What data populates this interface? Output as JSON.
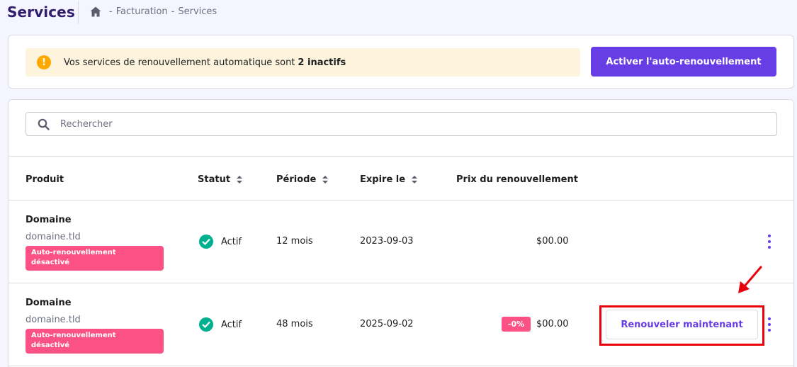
{
  "header": {
    "title": "Services",
    "breadcrumb": {
      "sep1": "-",
      "item1": "Facturation",
      "sep2": "-",
      "item2": "Services"
    }
  },
  "notice": {
    "text": "Vos services de renouvellement automatique sont",
    "highlight": "2 inactifs",
    "icon": "warning-icon",
    "button": "Activer l'auto-renouvellement"
  },
  "search": {
    "placeholder": "Rechercher"
  },
  "table": {
    "columns": {
      "produit": "Produit",
      "statut": "Statut",
      "periode": "Période",
      "expire": "Expire le",
      "prix": "Prix du renouvellement"
    },
    "rows": [
      {
        "name": "Domaine",
        "domain": "domaine.tld",
        "badge_line1": "Auto-renouvellement",
        "badge_line2": "désactivé",
        "status": "Actif",
        "period": "12 mois",
        "expires": "2023-09-03",
        "price": "$00.00"
      },
      {
        "name": "Domaine",
        "domain": "domaine.tld",
        "badge_line1": "Auto-renouvellement",
        "badge_line2": "désactivé",
        "status": "Actif",
        "period": "48 mois",
        "expires": "2025-09-02",
        "discount": "-0%",
        "price": "$00.00",
        "action": "Renouveler maintenant"
      }
    ]
  },
  "colors": {
    "brand": "#673de6",
    "title": "#2f1c6a",
    "danger": "#fc5185",
    "success": "#00b090",
    "warning": "#ffa900",
    "highlight": "#e8000b"
  }
}
